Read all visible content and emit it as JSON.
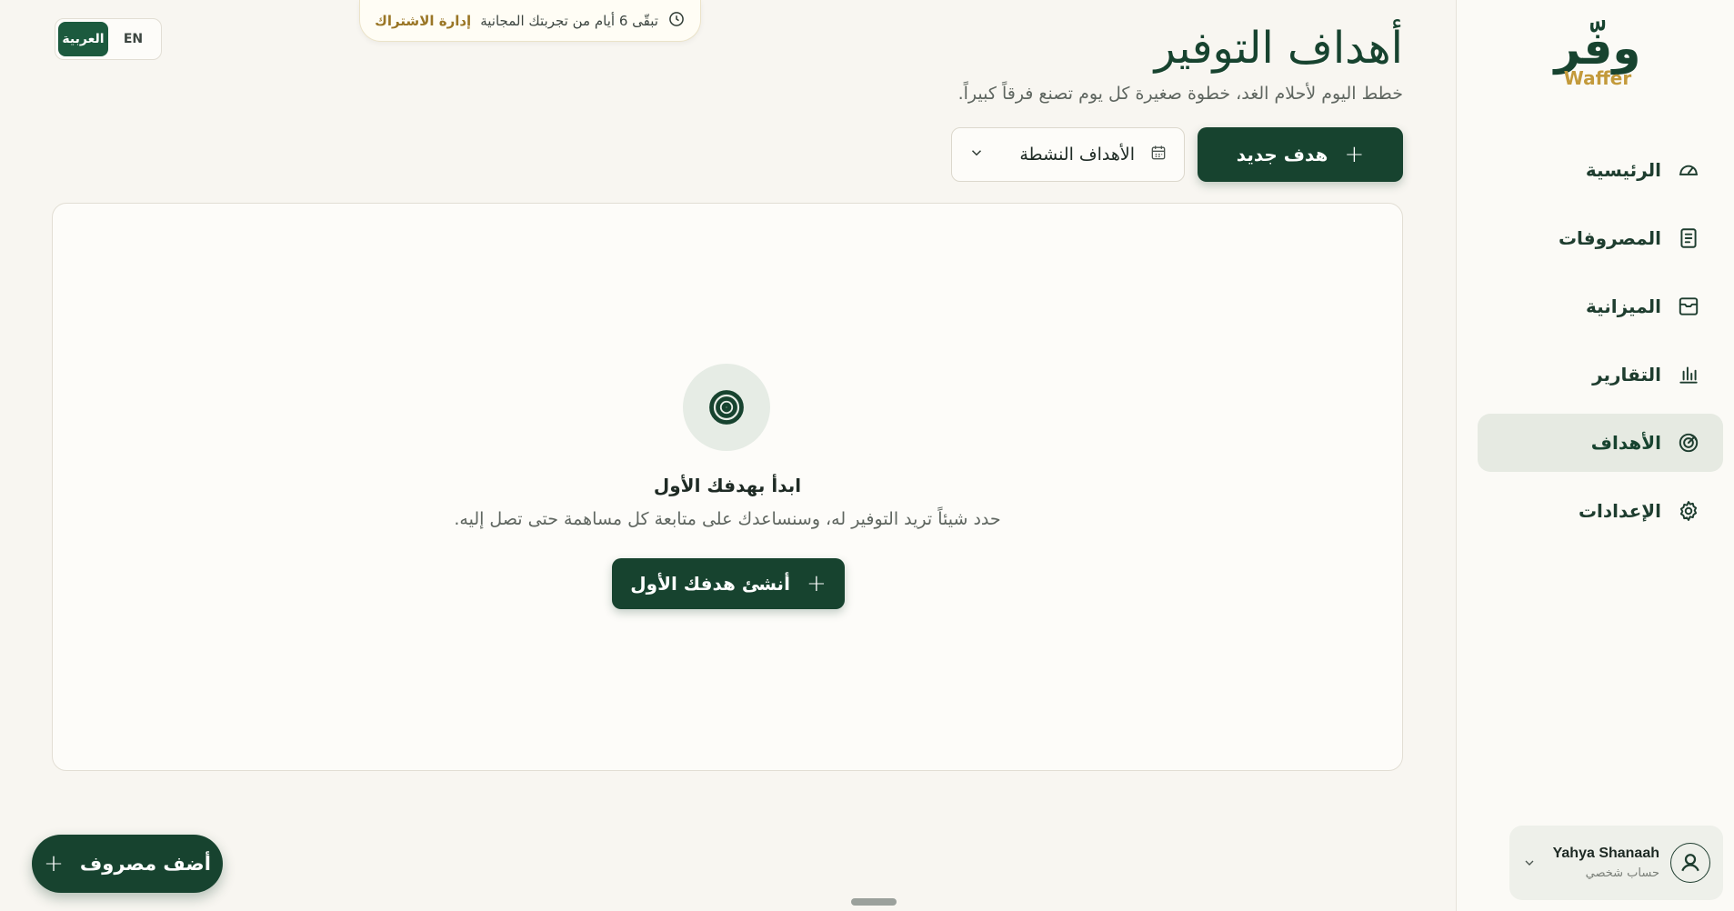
{
  "brand": {
    "name_ar": "وفّر",
    "name_en": "Waffer"
  },
  "sidebar": {
    "items": [
      {
        "label": "الرئيسية",
        "icon": "gauge-icon",
        "active": false
      },
      {
        "label": "المصروفات",
        "icon": "receipt-icon",
        "active": false
      },
      {
        "label": "الميزانية",
        "icon": "inbox-icon",
        "active": false
      },
      {
        "label": "التقارير",
        "icon": "bar-chart-icon",
        "active": false
      },
      {
        "label": "الأهداف",
        "icon": "target-icon",
        "active": true
      },
      {
        "label": "الإعدادات",
        "icon": "gear-icon",
        "active": false
      }
    ],
    "user": {
      "name": "Yahya Shanaah",
      "role": "حساب شخصي"
    }
  },
  "banner": {
    "trial_text": "تبقّى 6 أيام من تجربتك المجانية",
    "manage_link": "إدارة الاشتراك"
  },
  "lang": {
    "ar": "العربية",
    "en": "EN",
    "selected": "ar"
  },
  "page": {
    "title": "أهداف التوفير",
    "subtitle": "خطط اليوم لأحلام الغد، خطوة صغيرة كل يوم تصنع فرقاً كبيراً.",
    "new_goal_label": "هدف جديد",
    "filter_value": "الأهداف النشطة"
  },
  "empty_state": {
    "title": "ابدأ بهدفك الأول",
    "description": "حدد شيئاً تريد التوفير له، وسنساعدك على متابعة كل مساهمة حتى تصل إليه.",
    "cta_label": "أنشئ هدفك الأول"
  },
  "fab": {
    "label": "أضف مصروف"
  },
  "colors": {
    "primary": "#17432f",
    "accent_gold": "#c39a3b",
    "background": "#f8f6f1"
  }
}
